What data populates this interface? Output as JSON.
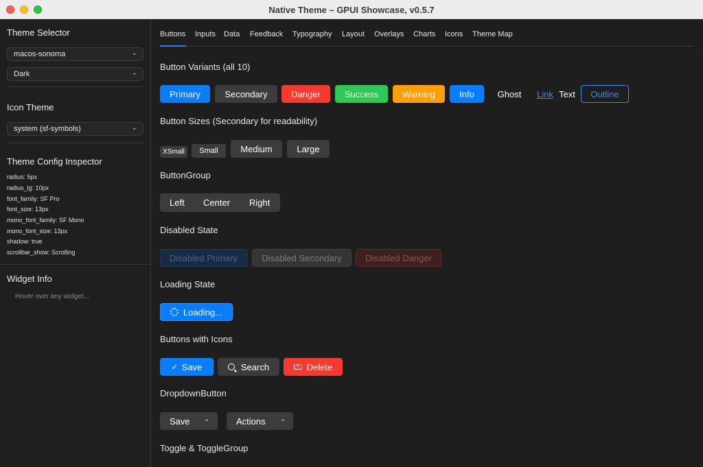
{
  "window": {
    "title": "Native Theme – GPUI Showcase, v0.5.7"
  },
  "sidebar": {
    "theme_selector_heading": "Theme Selector",
    "theme_value": "macos-sonoma",
    "mode_value": "Dark",
    "icon_theme_heading": "Icon Theme",
    "icon_theme_value": "system (sf-symbols)",
    "inspector_heading": "Theme Config Inspector",
    "config": [
      "radius: 5px",
      "radius_lg: 10px",
      "font_family: SF Pro",
      "font_size: 13px",
      "mono_font_family: SF Mono",
      "mono_font_size: 13px",
      "shadow: true",
      "scrollbar_show: Scrolling"
    ],
    "widget_info_heading": "Widget Info",
    "widget_info_text": "Hover over any widget..."
  },
  "tabs": [
    "Buttons",
    "Inputs",
    "Data",
    "Feedback",
    "Typography",
    "Layout",
    "Overlays",
    "Charts",
    "Icons",
    "Theme Map"
  ],
  "active_tab": "Buttons",
  "sections": {
    "variants": {
      "title": "Button Variants (all 10)",
      "buttons": [
        "Primary",
        "Secondary",
        "Danger",
        "Success",
        "Warning",
        "Info",
        "Ghost",
        "Link",
        "Text",
        "Outline"
      ]
    },
    "sizes": {
      "title": "Button Sizes (Secondary for readability)",
      "buttons": [
        "XSmall",
        "Small",
        "Medium",
        "Large"
      ]
    },
    "group": {
      "title": "ButtonGroup",
      "items": [
        "Left",
        "Center",
        "Right"
      ]
    },
    "disabled": {
      "title": "Disabled State",
      "buttons": [
        "Disabled Primary",
        "Disabled Secondary",
        "Disabled Danger"
      ]
    },
    "loading": {
      "title": "Loading State",
      "label": "Loading..."
    },
    "icons": {
      "title": "Buttons with Icons",
      "save": "Save",
      "search": "Search",
      "delete": "Delete",
      "save_icon": "checkmark-icon",
      "search_icon": "magnifier-icon",
      "delete_icon": "delete-backward-icon"
    },
    "dropdown": {
      "title": "DropdownButton",
      "save": "Save",
      "actions": "Actions"
    },
    "toggle": {
      "title": "Toggle & ToggleGroup"
    }
  },
  "colors": {
    "primary": "#0a7dfb",
    "danger": "#f53b30",
    "success": "#2fc755",
    "warning": "#fd9f0a",
    "secondary": "#3c3c3c",
    "link": "#3c8cf7"
  }
}
